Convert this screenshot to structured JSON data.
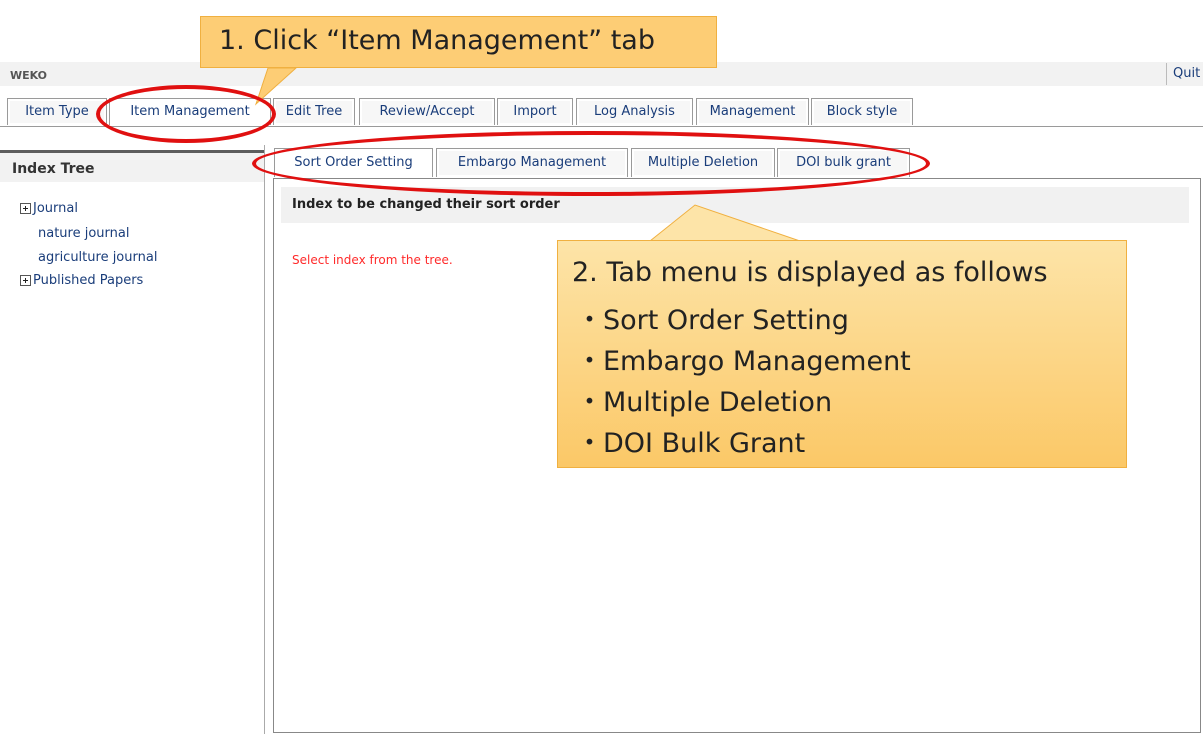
{
  "app": {
    "title": "WEKO",
    "quit_label": "Quit"
  },
  "main_tabs": [
    {
      "label": "Item Type"
    },
    {
      "label": "Item Management"
    },
    {
      "label": "Edit Tree"
    },
    {
      "label": "Review/Accept"
    },
    {
      "label": "Import"
    },
    {
      "label": "Log Analysis"
    },
    {
      "label": "Management"
    },
    {
      "label": "Block style"
    }
  ],
  "sidebar": {
    "title": "Index Tree",
    "nodes": [
      {
        "label": "Journal"
      },
      {
        "label": "nature journal"
      },
      {
        "label": "agriculture journal"
      },
      {
        "label": "Published Papers"
      }
    ]
  },
  "sub_tabs": [
    {
      "label": "Sort Order Setting"
    },
    {
      "label": "Embargo Management"
    },
    {
      "label": "Multiple Deletion"
    },
    {
      "label": "DOI bulk grant"
    }
  ],
  "panel": {
    "title": "Index to be changed their sort order",
    "hint": "Select index from the tree."
  },
  "annotations": {
    "step1": "1. Click “Item Management” tab",
    "step2": {
      "heading": "2. Tab menu is displayed as follows",
      "items": [
        "・Sort Order Setting",
        "・Embargo Management",
        "・Multiple Deletion",
        "・DOI Bulk Grant"
      ]
    }
  },
  "colors": {
    "link": "#1a3d7a",
    "highlight": "#e01010",
    "callout": "#fdcd75",
    "hint": "#ff2a2a"
  }
}
